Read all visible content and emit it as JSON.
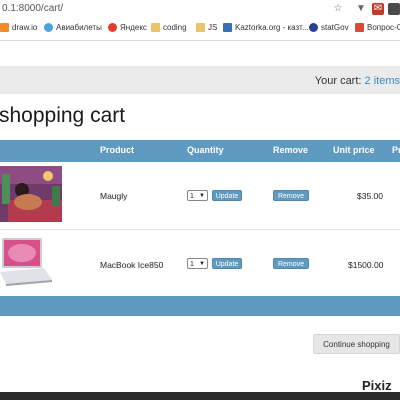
{
  "browser": {
    "url": "0.1:8000/cart/",
    "bookmarks": [
      {
        "label": "draw.io",
        "color": "#f28c28"
      },
      {
        "label": "Авиабилеты",
        "color": "#4aa3df"
      },
      {
        "label": "Яндекс",
        "color": "#e63b2e"
      },
      {
        "label": "coding",
        "color": "#e9c46a"
      },
      {
        "label": "JS",
        "color": "#e9c46a"
      },
      {
        "label": "Kaztorka.org - казт...",
        "color": "#3a6fb5"
      },
      {
        "label": "statGov",
        "color": "#2c3e91"
      },
      {
        "label": "Вопрос-О",
        "color": "#d84b3b"
      }
    ]
  },
  "header": {
    "cart_label": "Your cart:",
    "cart_items": "2 items"
  },
  "page": {
    "title": "shopping cart"
  },
  "table": {
    "columns": [
      "Product",
      "Quantity",
      "Remove",
      "Unit price",
      "Pr"
    ],
    "rows": [
      {
        "product": "Maugly",
        "quantity": "1",
        "update": "Update",
        "remove": "Remove",
        "unit_price": "$35.00"
      },
      {
        "product": "MacBook Ice850",
        "quantity": "1",
        "update": "Update",
        "remove": "Remove",
        "unit_price": "$1500.00"
      }
    ]
  },
  "actions": {
    "continue": "Continue shopping"
  },
  "watermark": "Pixiz",
  "colors": {
    "table_header": "#5f9ac1",
    "link": "#3b8ac4",
    "header_band": "#ebebeb"
  }
}
